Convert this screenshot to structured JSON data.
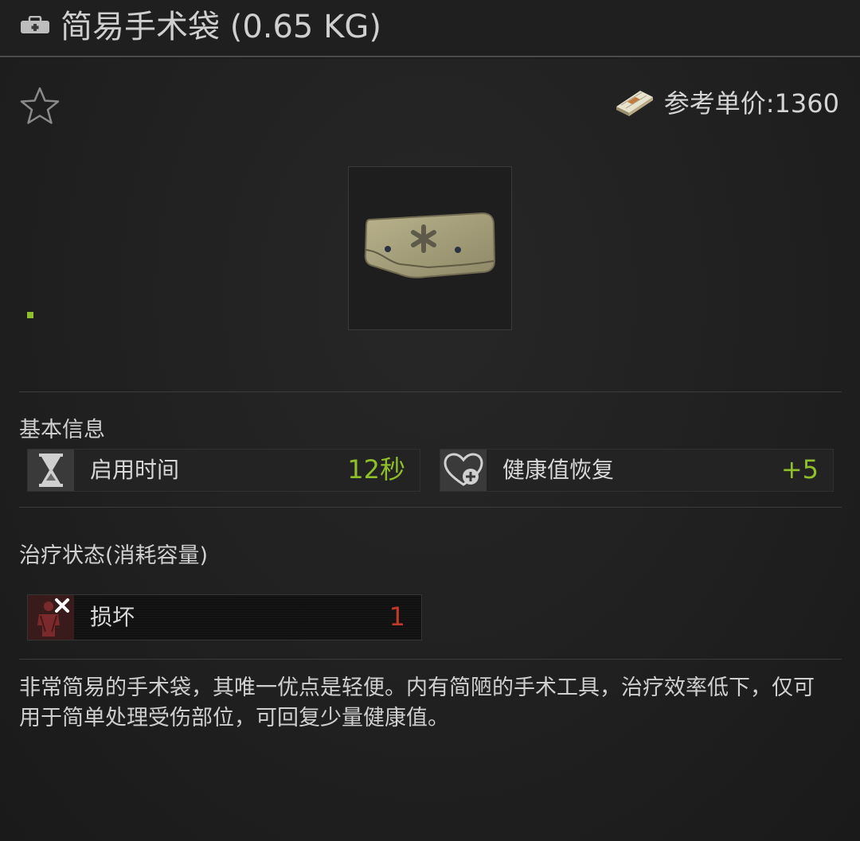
{
  "header": {
    "title": "简易手术袋 (0.65 KG)",
    "icon": "medkit-icon"
  },
  "favorite": {
    "icon": "star-outline-icon"
  },
  "price": {
    "icon": "money-bundle-icon",
    "label": "参考单价:1360"
  },
  "item": {
    "icon": "surgical-kit-icon",
    "rarity_color": "#8fbf2a"
  },
  "basic_info": {
    "title": "基本信息",
    "stats": [
      {
        "icon": "hourglass-icon",
        "label": "启用时间",
        "value": "12秒",
        "value_color": "#8fbf2a"
      },
      {
        "icon": "heart-plus-icon",
        "label": "健康值恢复",
        "value": "+5",
        "value_color": "#8fbf2a"
      }
    ]
  },
  "treatment": {
    "title": "治疗状态(消耗容量)",
    "items": [
      {
        "icon": "damaged-limb-icon",
        "label": "损坏",
        "value": "1",
        "value_color": "#c0392b"
      }
    ]
  },
  "description": "非常简易的手术袋，其唯一优点是轻便。内有简陋的手术工具，治疗效率低下，仅可用于简单处理受伤部位，可回复少量健康值。"
}
